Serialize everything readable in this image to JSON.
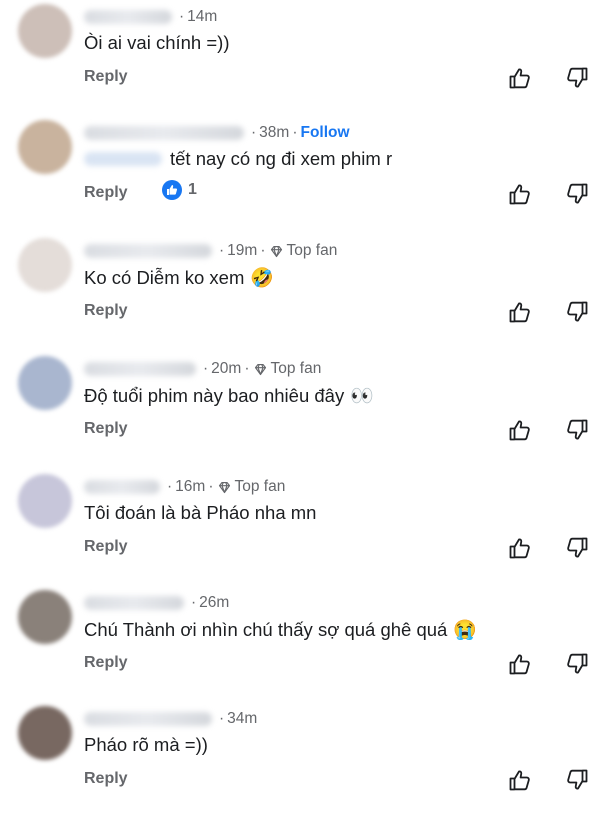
{
  "labels": {
    "reply": "Reply",
    "follow": "Follow",
    "top_fan": "Top fan"
  },
  "comments": [
    {
      "time": "14m",
      "text": "Òi ai vai chính =))",
      "avatar_color": "#cdbfb8",
      "name_width": 88
    },
    {
      "time": "38m",
      "text": "tết nay có ng đi xem phim r",
      "follow": true,
      "reaction_count": "1",
      "avatar_color": "#c9b39e",
      "name_width": 160
    },
    {
      "time": "19m",
      "text": "Ko có Diễm ko xem",
      "emoji": "🤣",
      "top_fan": true,
      "avatar_color": "#e4ddd9",
      "name_width": 128
    },
    {
      "time": "20m",
      "text": "Độ tuổi phim này bao nhiêu đây",
      "emoji": "👀",
      "top_fan": true,
      "avatar_color": "#a9b6cf",
      "name_width": 112
    },
    {
      "time": "16m",
      "text": "Tôi đoán là bà Pháo nha mn",
      "top_fan": true,
      "avatar_color": "#c7c6da",
      "name_width": 76
    },
    {
      "time": "26m",
      "text": "Chú Thành ơi nhìn chú thấy sợ quá ghê quá",
      "emoji": "😭",
      "avatar_color": "#8a817a",
      "name_width": 100
    },
    {
      "time": "34m",
      "text": "Pháo rõ mà =))",
      "avatar_color": "#786861",
      "name_width": 128
    }
  ]
}
